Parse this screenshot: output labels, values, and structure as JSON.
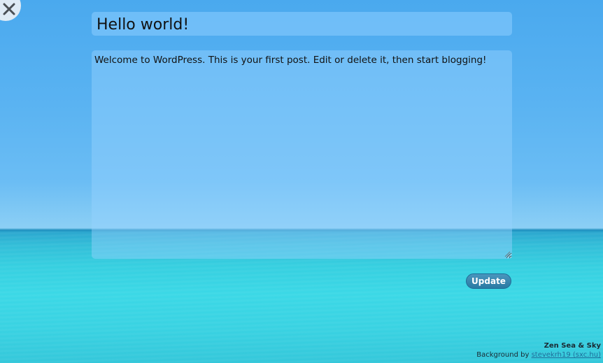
{
  "editor": {
    "title_value": "Hello world!",
    "content_value": "Welcome to WordPress. This is your first post. Edit or delete it, then start blogging!",
    "update_label": "Update"
  },
  "credits": {
    "theme_name": "Zen Sea & Sky",
    "background_prefix": "Background by ",
    "background_link_text": "stevekrh19 (sxc.hu)"
  },
  "icons": {
    "close": "close-icon",
    "resize": "resize-grip-icon"
  },
  "colors": {
    "sky": "#4aa9ee",
    "sea": "#38d2e2",
    "button": "#2a7aa3"
  }
}
